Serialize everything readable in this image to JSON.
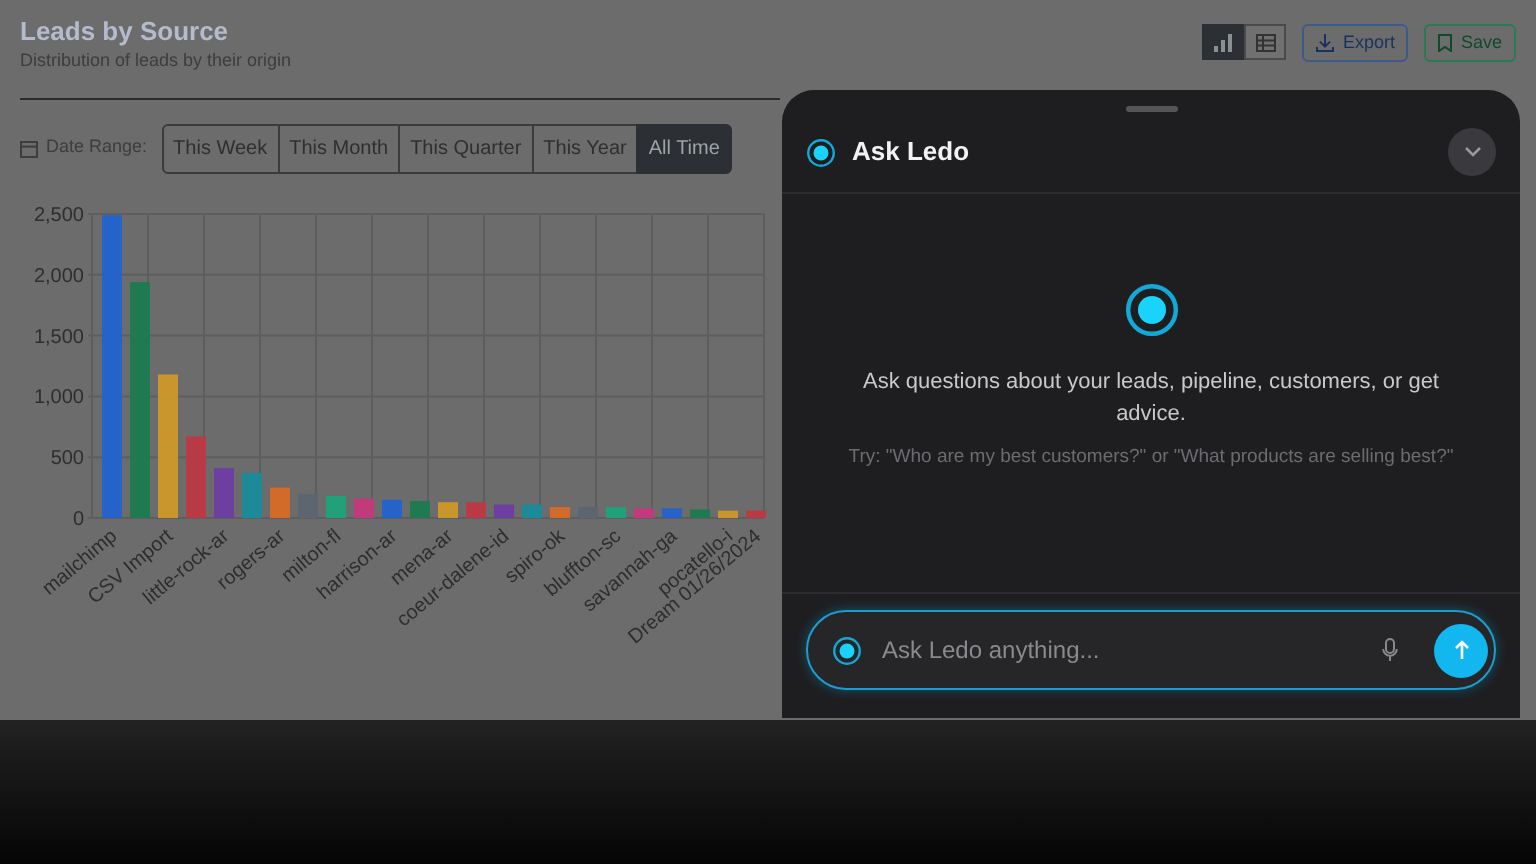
{
  "header": {
    "title": "Leads by Source",
    "subtitle": "Distribution of leads by their origin"
  },
  "view_toggle": [
    {
      "kind": "chart",
      "selected": true
    },
    {
      "kind": "table",
      "selected": false
    }
  ],
  "actions": [
    {
      "kind": "export",
      "label": "Export"
    },
    {
      "kind": "save",
      "label": "Save"
    }
  ],
  "date_range": {
    "label": "Date Range:",
    "options": [
      {
        "label": "This Week",
        "selected": false
      },
      {
        "label": "This Month",
        "selected": false
      },
      {
        "label": "This Quarter",
        "selected": false
      },
      {
        "label": "This Year",
        "selected": false
      },
      {
        "label": "All Time",
        "selected": true
      }
    ]
  },
  "chart": {
    "chart_data": {
      "type": "bar",
      "ylim": [
        0,
        2500
      ],
      "yticks": [
        {
          "value": 0,
          "label": "0"
        },
        {
          "value": 500,
          "label": "500"
        },
        {
          "value": 1000,
          "label": "1,000"
        },
        {
          "value": 1500,
          "label": "1,500"
        },
        {
          "value": 2000,
          "label": "2,000"
        },
        {
          "value": 2500,
          "label": "2,500"
        }
      ],
      "grid": true,
      "categories": [
        "mailchimp",
        null,
        "CSV Import",
        null,
        "little-rock-ar",
        null,
        "rogers-ar",
        null,
        "milton-fl",
        null,
        "harrison-ar",
        null,
        "mena-ar",
        null,
        "coeur-dalene-id",
        null,
        "spiro-ok",
        null,
        "bluffton-sc",
        null,
        "savannah-ga",
        null,
        "pocatello-i",
        "Dream 01/26/2024"
      ],
      "values": [
        2490,
        1940,
        1180,
        670,
        410,
        370,
        250,
        200,
        180,
        160,
        150,
        140,
        130,
        130,
        110,
        110,
        90,
        90,
        90,
        80,
        80,
        70,
        60,
        60
      ],
      "colors": [
        "#2563c8",
        "#1f7a52",
        "#c9962e",
        "#b83a45",
        "#6c3fa0",
        "#1d8a9a",
        "#d26a2a",
        "#5d6670",
        "#22a07a",
        "#c03a7c",
        "#2563c8",
        "#1f7a52",
        "#c9962e",
        "#b83a45",
        "#6c3fa0",
        "#1d8a9a",
        "#d26a2a",
        "#5d6670",
        "#22a07a",
        "#c03a7c",
        "#2563c8",
        "#1f7a52",
        "#c9962e",
        "#b83a45"
      ]
    }
  },
  "assistant": {
    "title": "Ask Ledo",
    "intro": "Ask questions about your leads, pipeline, customers, or get advice.",
    "hint": "Try: \"Who are my best customers?\" or \"What products are selling best?\"",
    "input": {
      "placeholder": "Ask Ledo anything..."
    }
  }
}
